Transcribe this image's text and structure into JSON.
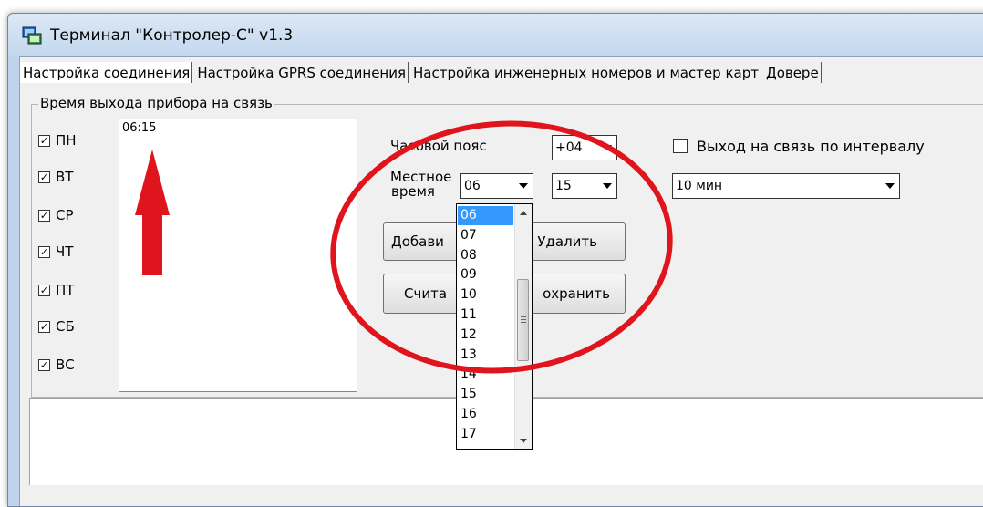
{
  "window": {
    "title": "Терминал \"Контролер-С\" v1.3"
  },
  "tabs": [
    {
      "label": "Настройка соединения"
    },
    {
      "label": "Настройка GPRS соединения"
    },
    {
      "label": "Настройка инженерных номеров и мастер карт"
    },
    {
      "label": "Довере"
    }
  ],
  "schedule": {
    "group_title": "Время выхода прибора на связь",
    "days": [
      {
        "label": "ПН",
        "checked": true
      },
      {
        "label": "ВТ",
        "checked": true
      },
      {
        "label": "СР",
        "checked": true
      },
      {
        "label": "ЧТ",
        "checked": true
      },
      {
        "label": "ПТ",
        "checked": true
      },
      {
        "label": "СБ",
        "checked": true
      },
      {
        "label": "ВС",
        "checked": true
      }
    ],
    "times": [
      "06:15"
    ],
    "timezone_label": "Часовой пояс",
    "timezone_value": "+04",
    "local_time_label_1": "Местное",
    "local_time_label_2": "время",
    "hour_value": "06",
    "minute_value": "15",
    "add_button": "Добави",
    "delete_button": "Удалить",
    "read_button": "Счита",
    "save_button": "охранить",
    "interval_checkbox_label": "Выход на связь по интервалу",
    "interval_checked": false,
    "interval_value": "10 мин",
    "hour_options": [
      "06",
      "07",
      "08",
      "09",
      "10",
      "11",
      "12",
      "13",
      "14",
      "15",
      "16",
      "17"
    ],
    "hour_selected": "06"
  },
  "colors": {
    "annotation_red": "#e0141c",
    "selection_blue": "#3399ff",
    "frame_blue": "#bfd3ea"
  },
  "icons": {
    "app": "terminal-app-icon",
    "checkmark": "check-icon"
  }
}
